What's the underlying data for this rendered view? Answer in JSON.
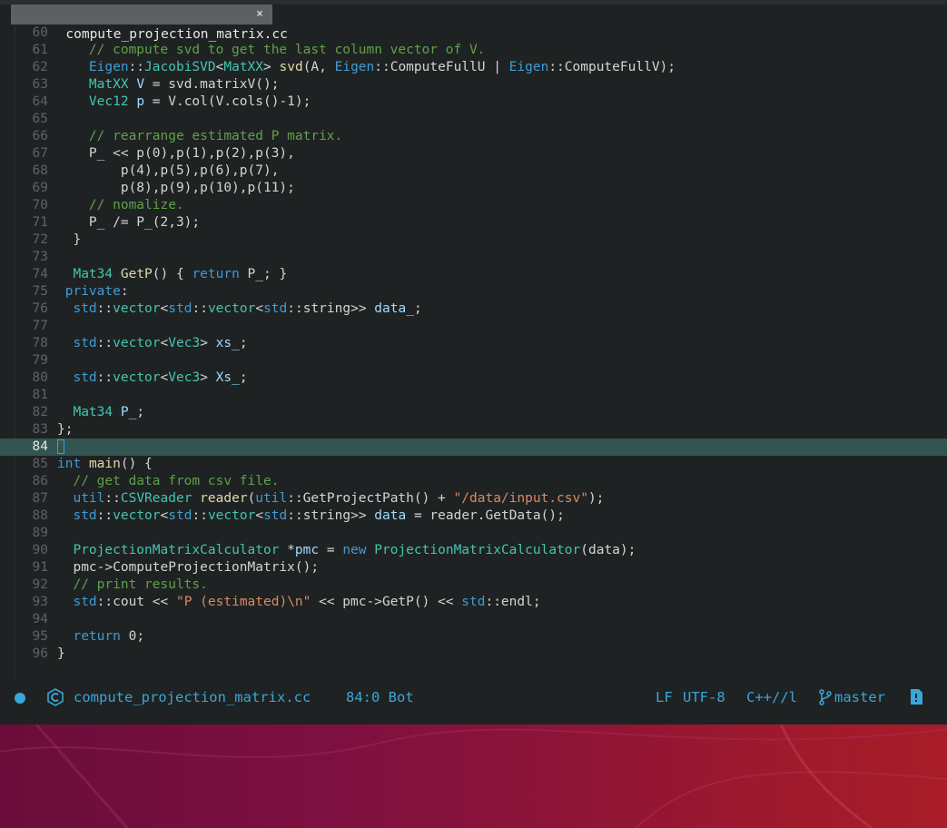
{
  "tab": {
    "title": "compute_projection_matrix.cc",
    "close": "×"
  },
  "editor": {
    "current_line": 84,
    "lines": [
      {
        "n": "60",
        "tokens": []
      },
      {
        "n": "61",
        "tokens": [
          [
            "cm",
            "    // compute svd to get the last column vector of V."
          ]
        ]
      },
      {
        "n": "62",
        "tokens": [
          [
            "pl",
            "    "
          ],
          [
            "ns",
            "Eigen"
          ],
          [
            "pl",
            "::"
          ],
          [
            "ty",
            "JacobiSVD"
          ],
          [
            "pl",
            "<"
          ],
          [
            "ty",
            "MatXX"
          ],
          [
            "pl",
            "> "
          ],
          [
            "fn",
            "svd"
          ],
          [
            "pl",
            "(A, "
          ],
          [
            "ns",
            "Eigen"
          ],
          [
            "pl",
            "::ComputeFullU | "
          ],
          [
            "ns",
            "Eigen"
          ],
          [
            "pl",
            "::ComputeFullV);"
          ]
        ]
      },
      {
        "n": "63",
        "tokens": [
          [
            "pl",
            "    "
          ],
          [
            "ty",
            "MatXX"
          ],
          [
            "pl",
            " "
          ],
          [
            "vr",
            "V"
          ],
          [
            "pl",
            " = svd.matrixV();"
          ]
        ]
      },
      {
        "n": "64",
        "tokens": [
          [
            "pl",
            "    "
          ],
          [
            "ty",
            "Vec12"
          ],
          [
            "pl",
            " "
          ],
          [
            "vr",
            "p"
          ],
          [
            "pl",
            " = V.col(V.cols()-1);"
          ]
        ]
      },
      {
        "n": "65",
        "tokens": []
      },
      {
        "n": "66",
        "tokens": [
          [
            "cm",
            "    // rearrange estimated P matrix."
          ]
        ]
      },
      {
        "n": "67",
        "tokens": [
          [
            "pl",
            "    P_ << p(0),p(1),p(2),p(3),"
          ]
        ]
      },
      {
        "n": "68",
        "tokens": [
          [
            "pl",
            "        p(4),p(5),p(6),p(7),"
          ]
        ]
      },
      {
        "n": "69",
        "tokens": [
          [
            "pl",
            "        p(8),p(9),p(10),p(11);"
          ]
        ]
      },
      {
        "n": "70",
        "tokens": [
          [
            "cm",
            "    // nomalize."
          ]
        ]
      },
      {
        "n": "71",
        "tokens": [
          [
            "pl",
            "    P_ /= P_(2,3);"
          ]
        ]
      },
      {
        "n": "72",
        "tokens": [
          [
            "pl",
            "  }"
          ]
        ]
      },
      {
        "n": "73",
        "tokens": []
      },
      {
        "n": "74",
        "tokens": [
          [
            "pl",
            "  "
          ],
          [
            "ty",
            "Mat34"
          ],
          [
            "pl",
            " "
          ],
          [
            "fn",
            "GetP"
          ],
          [
            "pl",
            "() { "
          ],
          [
            "kw",
            "return"
          ],
          [
            "pl",
            " P_; }"
          ]
        ]
      },
      {
        "n": "75",
        "tokens": [
          [
            "pl",
            " "
          ],
          [
            "kw",
            "private"
          ],
          [
            "pl",
            ":"
          ]
        ]
      },
      {
        "n": "76",
        "tokens": [
          [
            "pl",
            "  "
          ],
          [
            "ns",
            "std"
          ],
          [
            "pl",
            "::"
          ],
          [
            "ty",
            "vector"
          ],
          [
            "pl",
            "<"
          ],
          [
            "ns",
            "std"
          ],
          [
            "pl",
            "::"
          ],
          [
            "ty",
            "vector"
          ],
          [
            "pl",
            "<"
          ],
          [
            "ns",
            "std"
          ],
          [
            "pl",
            "::string>> "
          ],
          [
            "vr",
            "data_"
          ],
          [
            "pl",
            ";"
          ]
        ]
      },
      {
        "n": "77",
        "tokens": []
      },
      {
        "n": "78",
        "tokens": [
          [
            "pl",
            "  "
          ],
          [
            "ns",
            "std"
          ],
          [
            "pl",
            "::"
          ],
          [
            "ty",
            "vector"
          ],
          [
            "pl",
            "<"
          ],
          [
            "ty",
            "Vec3"
          ],
          [
            "pl",
            "> "
          ],
          [
            "vr",
            "xs_"
          ],
          [
            "pl",
            ";"
          ]
        ]
      },
      {
        "n": "79",
        "tokens": []
      },
      {
        "n": "80",
        "tokens": [
          [
            "pl",
            "  "
          ],
          [
            "ns",
            "std"
          ],
          [
            "pl",
            "::"
          ],
          [
            "ty",
            "vector"
          ],
          [
            "pl",
            "<"
          ],
          [
            "ty",
            "Vec3"
          ],
          [
            "pl",
            "> "
          ],
          [
            "vr",
            "Xs_"
          ],
          [
            "pl",
            ";"
          ]
        ]
      },
      {
        "n": "81",
        "tokens": []
      },
      {
        "n": "82",
        "tokens": [
          [
            "pl",
            "  "
          ],
          [
            "ty",
            "Mat34"
          ],
          [
            "pl",
            " "
          ],
          [
            "vr",
            "P_"
          ],
          [
            "pl",
            ";"
          ]
        ]
      },
      {
        "n": "83",
        "tokens": [
          [
            "pl",
            "};"
          ]
        ]
      },
      {
        "n": "84",
        "tokens": []
      },
      {
        "n": "85",
        "tokens": [
          [
            "kw",
            "int"
          ],
          [
            "pl",
            " "
          ],
          [
            "fn",
            "main"
          ],
          [
            "pl",
            "() {"
          ]
        ]
      },
      {
        "n": "86",
        "tokens": [
          [
            "cm",
            "  // get data from csv file."
          ]
        ]
      },
      {
        "n": "87",
        "tokens": [
          [
            "pl",
            "  "
          ],
          [
            "ns",
            "util"
          ],
          [
            "pl",
            "::"
          ],
          [
            "ty",
            "CSVReader"
          ],
          [
            "pl",
            " "
          ],
          [
            "fn",
            "reader"
          ],
          [
            "pl",
            "("
          ],
          [
            "ns",
            "util"
          ],
          [
            "pl",
            "::GetProjectPath() + "
          ],
          [
            "st",
            "\"/data/input.csv\""
          ],
          [
            "pl",
            ");"
          ]
        ]
      },
      {
        "n": "88",
        "tokens": [
          [
            "pl",
            "  "
          ],
          [
            "ns",
            "std"
          ],
          [
            "pl",
            "::"
          ],
          [
            "ty",
            "vector"
          ],
          [
            "pl",
            "<"
          ],
          [
            "ns",
            "std"
          ],
          [
            "pl",
            "::"
          ],
          [
            "ty",
            "vector"
          ],
          [
            "pl",
            "<"
          ],
          [
            "ns",
            "std"
          ],
          [
            "pl",
            "::string>> "
          ],
          [
            "vr",
            "data"
          ],
          [
            "pl",
            " = reader.GetData();"
          ]
        ]
      },
      {
        "n": "89",
        "tokens": []
      },
      {
        "n": "90",
        "tokens": [
          [
            "pl",
            "  "
          ],
          [
            "ty",
            "ProjectionMatrixCalculator"
          ],
          [
            "pl",
            " *"
          ],
          [
            "vr",
            "pmc"
          ],
          [
            "pl",
            " = "
          ],
          [
            "kw",
            "new"
          ],
          [
            "pl",
            " "
          ],
          [
            "ty",
            "ProjectionMatrixCalculator"
          ],
          [
            "pl",
            "(data);"
          ]
        ]
      },
      {
        "n": "91",
        "tokens": [
          [
            "pl",
            "  pmc->ComputeProjectionMatrix();"
          ]
        ]
      },
      {
        "n": "92",
        "tokens": [
          [
            "cm",
            "  // print results."
          ]
        ]
      },
      {
        "n": "93",
        "tokens": [
          [
            "pl",
            "  "
          ],
          [
            "ns",
            "std"
          ],
          [
            "pl",
            "::cout << "
          ],
          [
            "st",
            "\"P (estimated)\\n\""
          ],
          [
            "pl",
            " << pmc->GetP() << "
          ],
          [
            "ns",
            "std"
          ],
          [
            "pl",
            "::endl;"
          ]
        ]
      },
      {
        "n": "94",
        "tokens": []
      },
      {
        "n": "95",
        "tokens": [
          [
            "pl",
            "  "
          ],
          [
            "kw",
            "return"
          ],
          [
            "pl",
            " 0;"
          ]
        ]
      },
      {
        "n": "96",
        "tokens": [
          [
            "pl",
            "}"
          ]
        ]
      }
    ]
  },
  "statusbar": {
    "filename": "compute_projection_matrix.cc",
    "position": "84:0 Bot",
    "line_ending": "LF",
    "encoding": "UTF-8",
    "mode": "C++//l",
    "branch": "master",
    "icons": [
      "modified-dot-icon",
      "cpp-file-icon",
      "git-branch-icon",
      "save-file-icon"
    ]
  },
  "colors": {
    "comment": "#5fa148",
    "namespace": "#3f9cd6",
    "type": "#43c5b0",
    "keyword": "#3f9cd6",
    "function": "#e0d9a8",
    "string": "#d98a62",
    "current_line_bg": "#325551",
    "status_accent": "#3aa6d8"
  }
}
